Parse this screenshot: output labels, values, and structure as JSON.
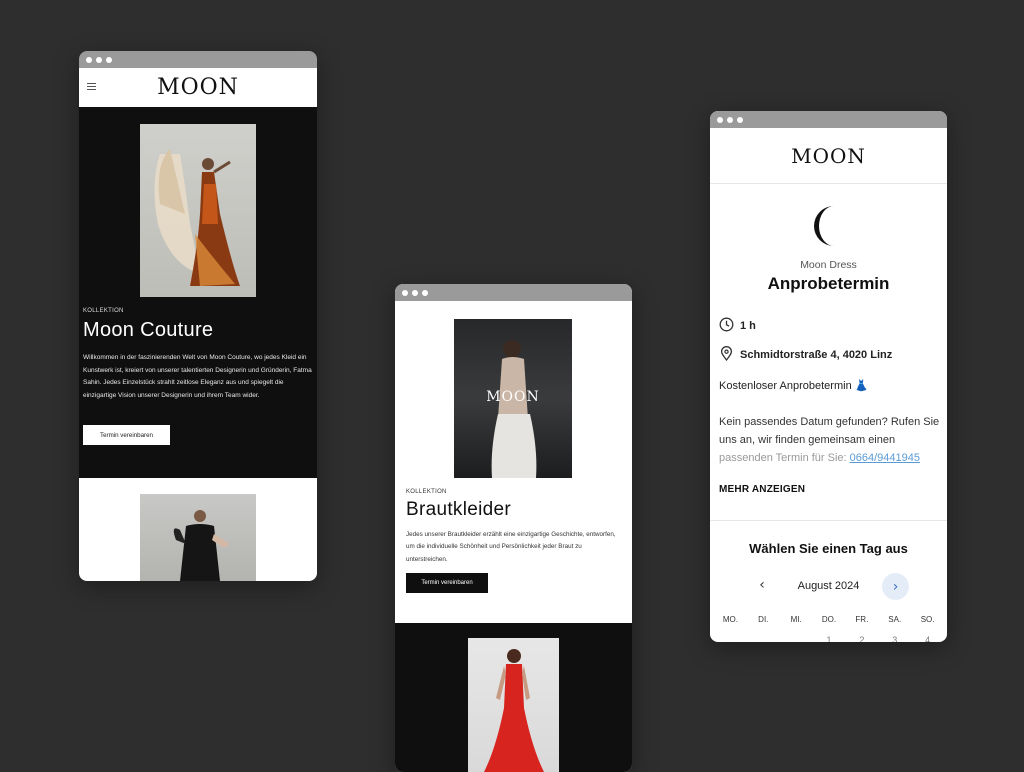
{
  "brand": {
    "logo": "MOON"
  },
  "couture_page": {
    "section_label": "KOLLEKTION",
    "title": "Moon Couture",
    "description": "Willkommen in der faszinierenden Welt von Moon Couture, wo jedes Kleid ein Kunstwerk ist, kreiert von unserer talentierten Designerin und Gründerin, Fatma Sahin. Jedes Einzelstück strahlt zeitlose Eleganz aus und spiegelt die einzigartige Vision unserer Designerin und ihrem Team wider.",
    "cta_label": "Termin vereinbaren"
  },
  "bridal_page": {
    "image_overlay_logo": "MOON",
    "section_label": "KOLLEKTION",
    "title": "Brautkleider",
    "description": "Jedes unserer Brautkleider erzählt eine einzigartige Geschichte, entworfen, um die individuelle Schönheit und Persönlichkeit jeder Braut zu unterstreichen.",
    "cta_label": "Termin vereinbaren"
  },
  "booking_page": {
    "brand_name": "Moon Dress",
    "heading": "Anprobetermin",
    "duration": "1 h",
    "address": "Schmidtorstraße 4, 4020 Linz",
    "free_note": "Kostenloser Anprobetermin",
    "desc_part1": "Kein passendes Datum gefunden? Rufen Sie uns an, wir finden gemeinsam einen",
    "desc_part2": "passenden Termin für Sie:",
    "phone": "0664/9441945",
    "more_label": "MEHR ANZEIGEN",
    "calendar_title": "Wählen Sie einen Tag aus",
    "month": "August 2024",
    "weekdays": [
      "MO.",
      "DI.",
      "MI.",
      "DO.",
      "FR.",
      "SA.",
      "SO."
    ],
    "first_days": [
      "",
      "",
      "",
      "1",
      "2",
      "3",
      "4"
    ]
  },
  "colors": {
    "background": "#2e2e2f",
    "dark_panel": "#0f0f10",
    "link": "#5b9bd5",
    "accent_circle": "#e4ecf7"
  },
  "icons": [
    "menu-icon",
    "clock-icon",
    "location-pin-icon",
    "moon-logo-icon",
    "chevron-left-icon",
    "chevron-right-icon"
  ]
}
